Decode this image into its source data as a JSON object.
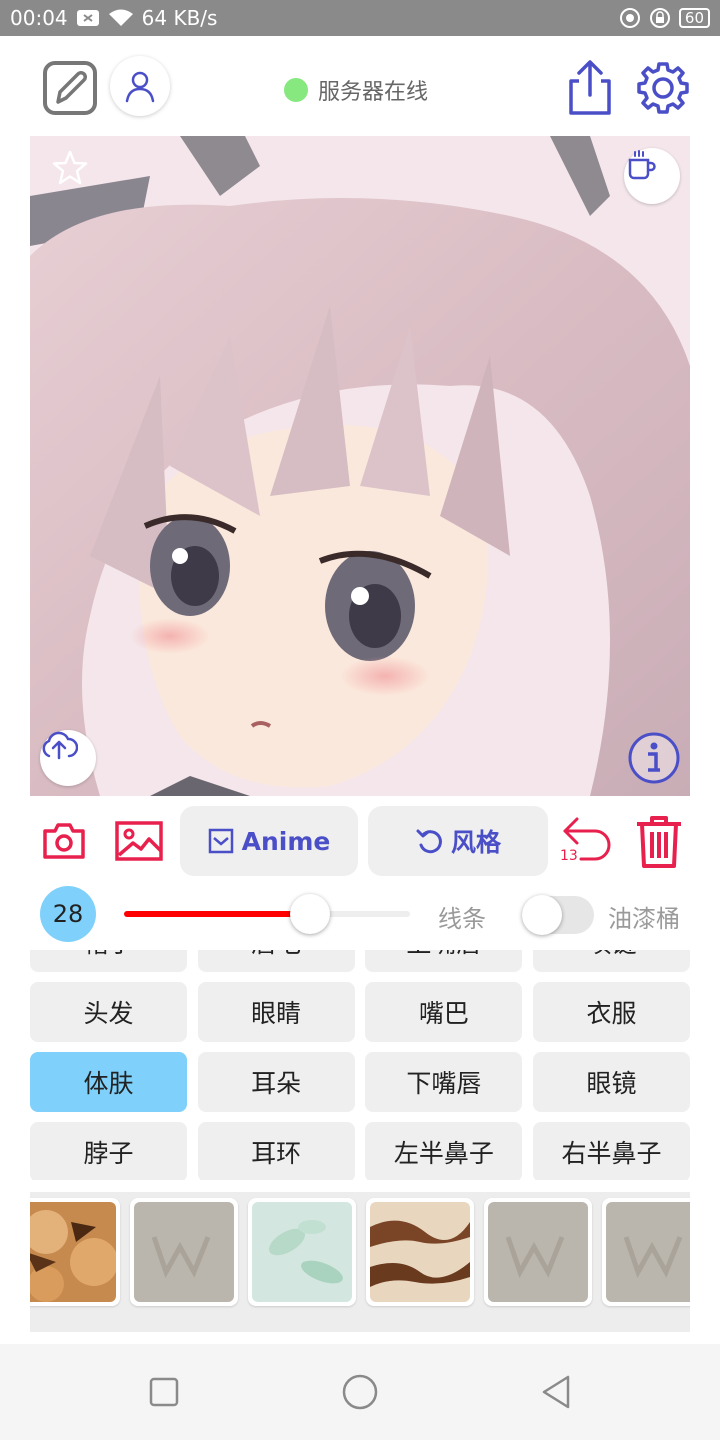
{
  "status_bar": {
    "time": "00:04",
    "net_speed": "64 KB/s",
    "battery": "60"
  },
  "header": {
    "server_status": "服务器在线"
  },
  "toolbar": {
    "anime_label": "Anime",
    "style_label": "风格",
    "undo_count": "13"
  },
  "brush": {
    "size": "28",
    "level_fraction": 0.65,
    "line_label": "线条",
    "bucket_label": "油漆桶",
    "bucket_enabled": false
  },
  "parts": [
    {
      "label": "帽子",
      "active": false
    },
    {
      "label": "眉毛",
      "active": false
    },
    {
      "label": "上嘴唇",
      "active": false
    },
    {
      "label": "项链",
      "active": false
    },
    {
      "label": "头发",
      "active": false
    },
    {
      "label": "眼睛",
      "active": false
    },
    {
      "label": "嘴巴",
      "active": false
    },
    {
      "label": "衣服",
      "active": false
    },
    {
      "label": "体肤",
      "active": true
    },
    {
      "label": "耳朵",
      "active": false
    },
    {
      "label": "下嘴唇",
      "active": false
    },
    {
      "label": "眼镜",
      "active": false
    },
    {
      "label": "脖子",
      "active": false
    },
    {
      "label": "耳环",
      "active": false
    },
    {
      "label": "左半鼻子",
      "active": false
    },
    {
      "label": "右半鼻子",
      "active": false
    }
  ],
  "colors": {
    "accent": "#4a4fc8",
    "danger": "#e8204d",
    "active_cell": "#7fd1fb",
    "server_online": "#86e87f"
  }
}
